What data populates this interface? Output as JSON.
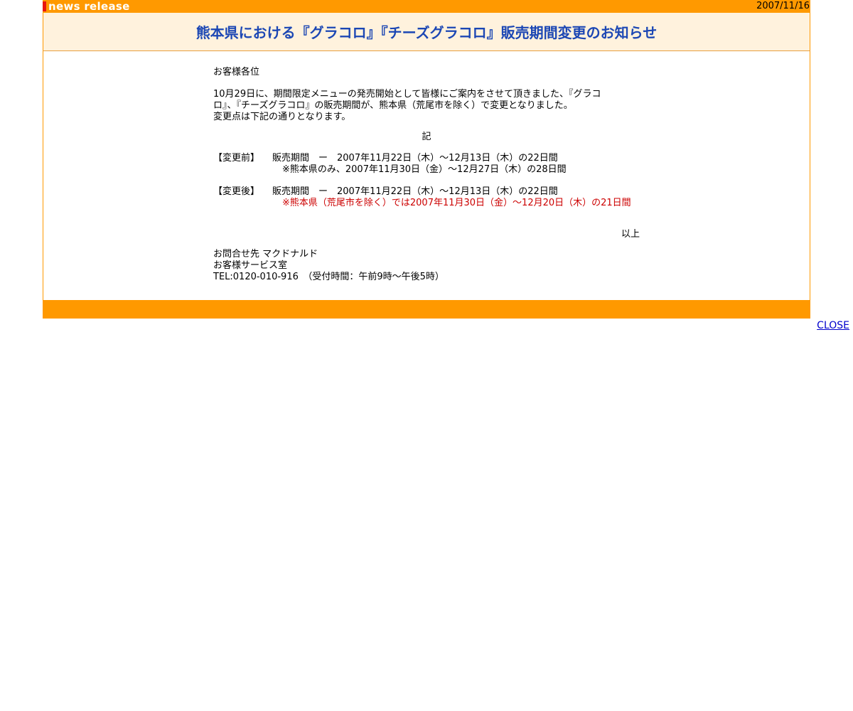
{
  "header": {
    "logo_text": "news release",
    "date": "2007/11/16"
  },
  "title": "熊本県における『グラコロ』『チーズグラコロ』販売期間変更のお知らせ",
  "body": {
    "greeting": "お客様各位",
    "intro_line1": "10月29日に、期間限定メニューの発売開始として皆様にご案内をさせて頂きました、『グラコ",
    "intro_line2": "ロ』、『チーズグラコロ』の販売期間が、熊本県（荒尾市を除く）で変更となりました。",
    "intro_line3": "変更点は下記の通りとなります。",
    "ki": "記",
    "before": {
      "label": "【変更前】",
      "line1": "販売期間　ー　2007年11月22日（木）～12月13日（木）の22日間",
      "line2": "※熊本県のみ、2007年11月30日（金）～12月27日（木）の28日間"
    },
    "after": {
      "label": "【変更後】",
      "line1": "販売期間　ー　2007年11月22日（木）～12月13日（木）の22日間",
      "line2": "※熊本県（荒尾市を除く）では2007年11月30日（金）～12月20日（木）の21日間"
    },
    "ijou": "以上",
    "contact_line1": "お問合せ先 マクドナルド",
    "contact_line2": "お客様サービス室",
    "contact_line3": "TEL:0120-010-916　（受付時間：午前9時～午後5時）"
  },
  "footer": {
    "close_label": "CLOSE"
  },
  "colors": {
    "bar": "#ff9900",
    "title_bg": "#fff2dd",
    "title_text": "#1c47b4",
    "highlight_text": "#cc0000"
  }
}
